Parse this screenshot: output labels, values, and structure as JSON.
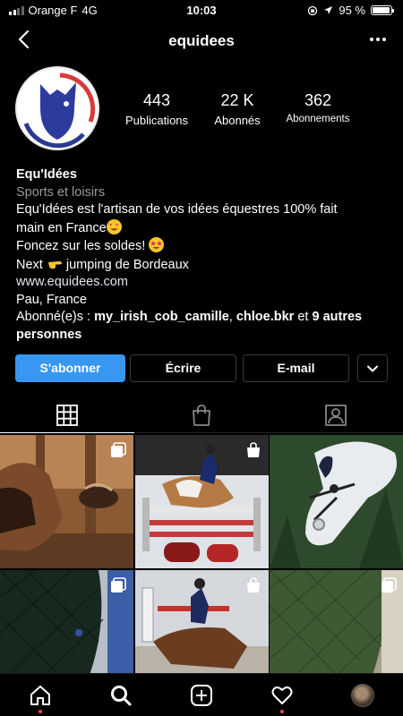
{
  "status_bar": {
    "carrier": "Orange F",
    "network": "4G",
    "time": "10:03",
    "battery": "95 %",
    "battery_level": 0.95
  },
  "header": {
    "username": "equidees"
  },
  "profile": {
    "stats": [
      {
        "value": "443",
        "label": "Publications"
      },
      {
        "value": "22 K",
        "label": "Abonnés"
      },
      {
        "value": "362",
        "label": "Abonnements"
      }
    ],
    "name": "Equ'Idées",
    "category": "Sports et loisirs",
    "bio_line1": "Equ'Idées est l'artisan de vos idées équestres 100% fait",
    "bio_line2": "main en France",
    "bio_line3": "Foncez sur les soldes!",
    "bio_line4_a": "Next",
    "bio_line4_b": "jumping de Bordeaux",
    "website": "www.equidees.com",
    "location": "Pau, France",
    "followed_by_prefix": "Abonné(e)s :",
    "followed_by_user1": "my_irish_cob_camille",
    "followed_by_sep": ",",
    "followed_by_user2": "chloe.bkr",
    "followed_by_and": "et",
    "followed_by_more": "9 autres personnes"
  },
  "buttons": {
    "follow": "S'abonner",
    "message": "Écrire",
    "email": "E-mail"
  },
  "tabs": [
    "grid-icon",
    "shopping-bag-icon",
    "tagged-person-icon"
  ],
  "nav": [
    "home-icon",
    "search-icon",
    "new-post-icon",
    "heart-icon",
    "profile-avatar"
  ],
  "colors": {
    "accent": "#3897f0",
    "background": "#000000",
    "notification_dot": "#ed4956"
  }
}
